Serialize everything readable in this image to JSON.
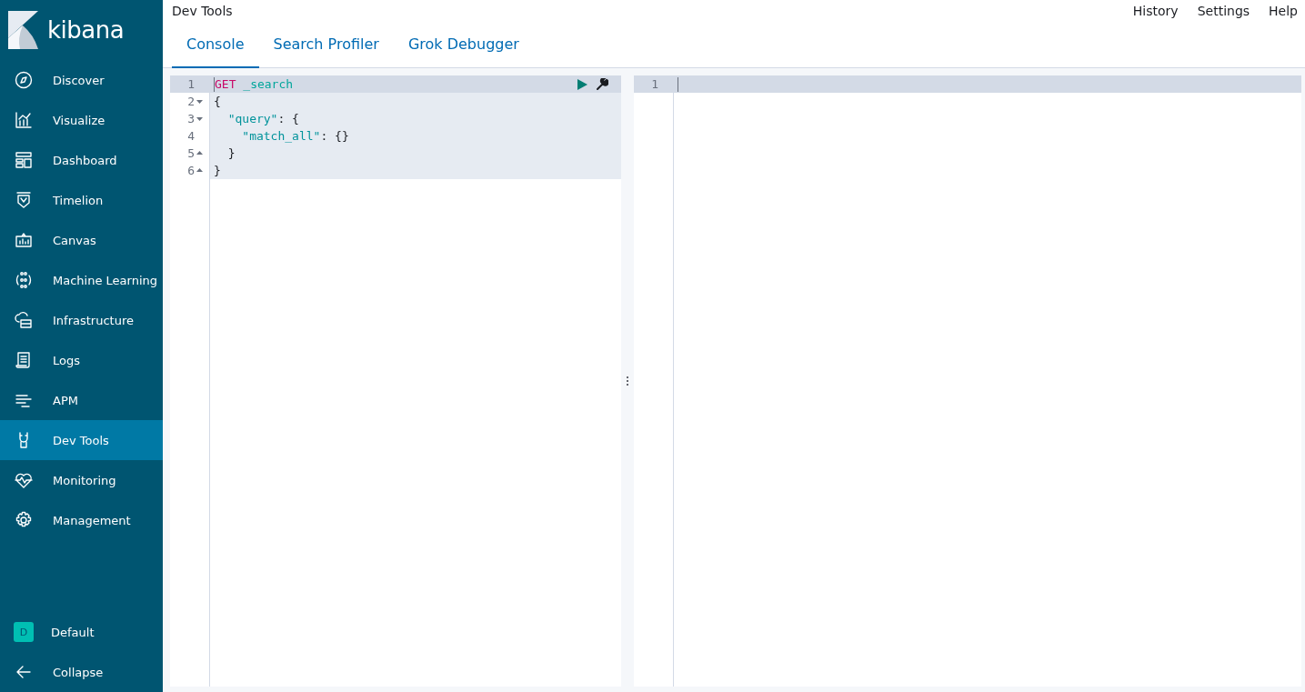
{
  "brand": {
    "name": "kibana"
  },
  "nav": {
    "items": [
      {
        "label": "Discover",
        "selected": false
      },
      {
        "label": "Visualize",
        "selected": false
      },
      {
        "label": "Dashboard",
        "selected": false
      },
      {
        "label": "Timelion",
        "selected": false
      },
      {
        "label": "Canvas",
        "selected": false
      },
      {
        "label": "Machine Learning",
        "selected": false
      },
      {
        "label": "Infrastructure",
        "selected": false
      },
      {
        "label": "Logs",
        "selected": false
      },
      {
        "label": "APM",
        "selected": false
      },
      {
        "label": "Dev Tools",
        "selected": true
      },
      {
        "label": "Monitoring",
        "selected": false
      },
      {
        "label": "Management",
        "selected": false
      }
    ],
    "space": {
      "initial": "D",
      "label": "Default"
    },
    "collapse": {
      "label": "Collapse"
    }
  },
  "header": {
    "title": "Dev Tools",
    "links": [
      "History",
      "Settings",
      "Help"
    ]
  },
  "tabs": [
    {
      "label": "Console",
      "selected": true
    },
    {
      "label": "Search Profiler",
      "selected": false
    },
    {
      "label": "Grok Debugger",
      "selected": false
    }
  ],
  "editor": {
    "lines": [
      {
        "number": "1",
        "fold_start": false,
        "fold_end": false,
        "active": true,
        "tokens": [
          {
            "kind": "method",
            "text": "GET"
          },
          {
            "kind": "url",
            "text": " _search"
          }
        ]
      },
      {
        "number": "2",
        "fold_start": true,
        "fold_end": false,
        "active": false,
        "tokens": [
          {
            "kind": "punct",
            "text": "{"
          }
        ]
      },
      {
        "number": "3",
        "fold_start": true,
        "fold_end": false,
        "active": false,
        "tokens": [
          {
            "kind": "string",
            "text": "  \"query\""
          },
          {
            "kind": "punct",
            "text": ": {"
          }
        ]
      },
      {
        "number": "4",
        "fold_start": false,
        "fold_end": false,
        "active": false,
        "tokens": [
          {
            "kind": "string",
            "text": "    \"match_all\""
          },
          {
            "kind": "punct",
            "text": ": {}"
          }
        ]
      },
      {
        "number": "5",
        "fold_start": false,
        "fold_end": true,
        "active": false,
        "tokens": [
          {
            "kind": "punct",
            "text": "  }"
          }
        ]
      },
      {
        "number": "6",
        "fold_start": false,
        "fold_end": true,
        "active": false,
        "tokens": [
          {
            "kind": "punct",
            "text": "}"
          }
        ]
      }
    ]
  },
  "output": {
    "lines": [
      {
        "number": "1",
        "active": true
      }
    ]
  }
}
